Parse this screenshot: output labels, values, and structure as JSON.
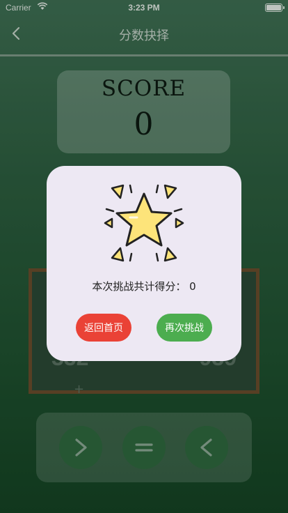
{
  "status_bar": {
    "carrier": "Carrier",
    "time": "3:23 PM"
  },
  "nav": {
    "title": "分数抉择"
  },
  "score": {
    "label": "SCORE",
    "value": "0"
  },
  "board": {
    "left_number": "332",
    "right_number": "939",
    "marker": "+"
  },
  "controls": [
    {
      "name": "greater-than-button",
      "icon": "greater-than-icon"
    },
    {
      "name": "equals-button",
      "icon": "equals-icon"
    },
    {
      "name": "less-than-button",
      "icon": "less-than-icon"
    }
  ],
  "dialog": {
    "result_text": "本次挑战共计得分：  0",
    "home_button_label": "返回首页",
    "retry_button_label": "再次挑战",
    "colors": {
      "home": "#ea4236",
      "retry": "#4cad4f",
      "star": "#fde47a"
    }
  }
}
